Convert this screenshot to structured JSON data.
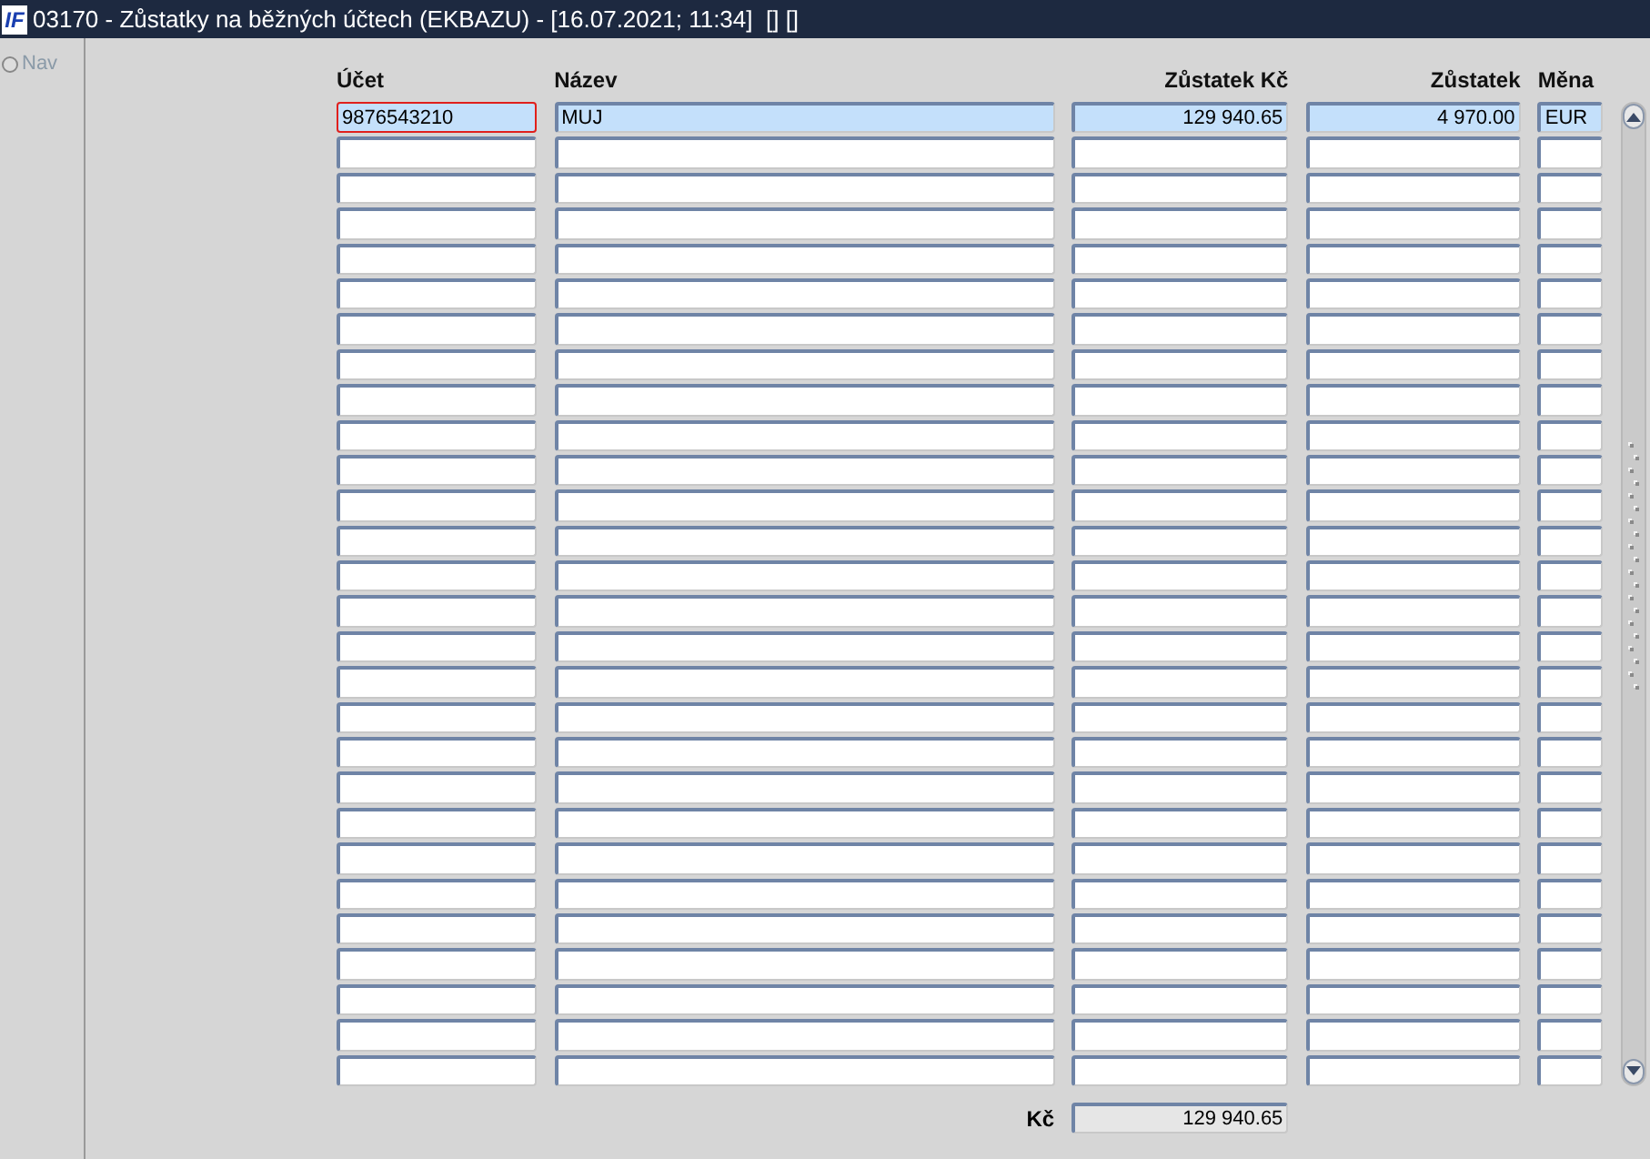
{
  "window": {
    "logo": "IF",
    "title": "03170 - Zůstatky na běžných účtech (EKBAZU) - [16.07.2021; 11:34]  [] []"
  },
  "sidebar": {
    "nav": {
      "label": "Nav",
      "selected": false,
      "disabled": true
    }
  },
  "table": {
    "columns": [
      {
        "label": "Účet",
        "kind": "text"
      },
      {
        "label": "Název",
        "kind": "text"
      },
      {
        "label": "Zůstatek Kč",
        "kind": "amount"
      },
      {
        "label": "Zůstatek",
        "kind": "amount"
      },
      {
        "label": "Měna",
        "kind": "text"
      }
    ],
    "rows": [
      {
        "cells": [
          "9876543210",
          "MUJ",
          "129 940.65",
          "4 970.00",
          "EUR"
        ],
        "selected": true,
        "focused": true
      },
      {
        "cells": [],
        "selected": false,
        "focused": false
      },
      {
        "cells": [],
        "selected": false,
        "focused": false
      },
      {
        "cells": [],
        "selected": false,
        "focused": false
      },
      {
        "cells": [],
        "selected": false,
        "focused": false
      },
      {
        "cells": [],
        "selected": false,
        "focused": false
      },
      {
        "cells": [],
        "selected": false,
        "focused": false
      },
      {
        "cells": [],
        "selected": false,
        "focused": false
      },
      {
        "cells": [],
        "selected": false,
        "focused": false
      },
      {
        "cells": [],
        "selected": false,
        "focused": false
      },
      {
        "cells": [],
        "selected": false,
        "focused": false
      },
      {
        "cells": [],
        "selected": false,
        "focused": false
      },
      {
        "cells": [],
        "selected": false,
        "focused": false
      },
      {
        "cells": [],
        "selected": false,
        "focused": false
      },
      {
        "cells": [],
        "selected": false,
        "focused": false
      },
      {
        "cells": [],
        "selected": false,
        "focused": false
      },
      {
        "cells": [],
        "selected": false,
        "focused": false
      },
      {
        "cells": [],
        "selected": false,
        "focused": false
      },
      {
        "cells": [],
        "selected": false,
        "focused": false
      },
      {
        "cells": [],
        "selected": false,
        "focused": false
      },
      {
        "cells": [],
        "selected": false,
        "focused": false
      },
      {
        "cells": [],
        "selected": false,
        "focused": false
      },
      {
        "cells": [],
        "selected": false,
        "focused": false
      },
      {
        "cells": [],
        "selected": false,
        "focused": false
      },
      {
        "cells": [],
        "selected": false,
        "focused": false
      },
      {
        "cells": [],
        "selected": false,
        "focused": false
      },
      {
        "cells": [],
        "selected": false,
        "focused": false
      },
      {
        "cells": [],
        "selected": false,
        "focused": false
      }
    ]
  },
  "total": {
    "label": "Kč",
    "value": "129 940.65"
  }
}
